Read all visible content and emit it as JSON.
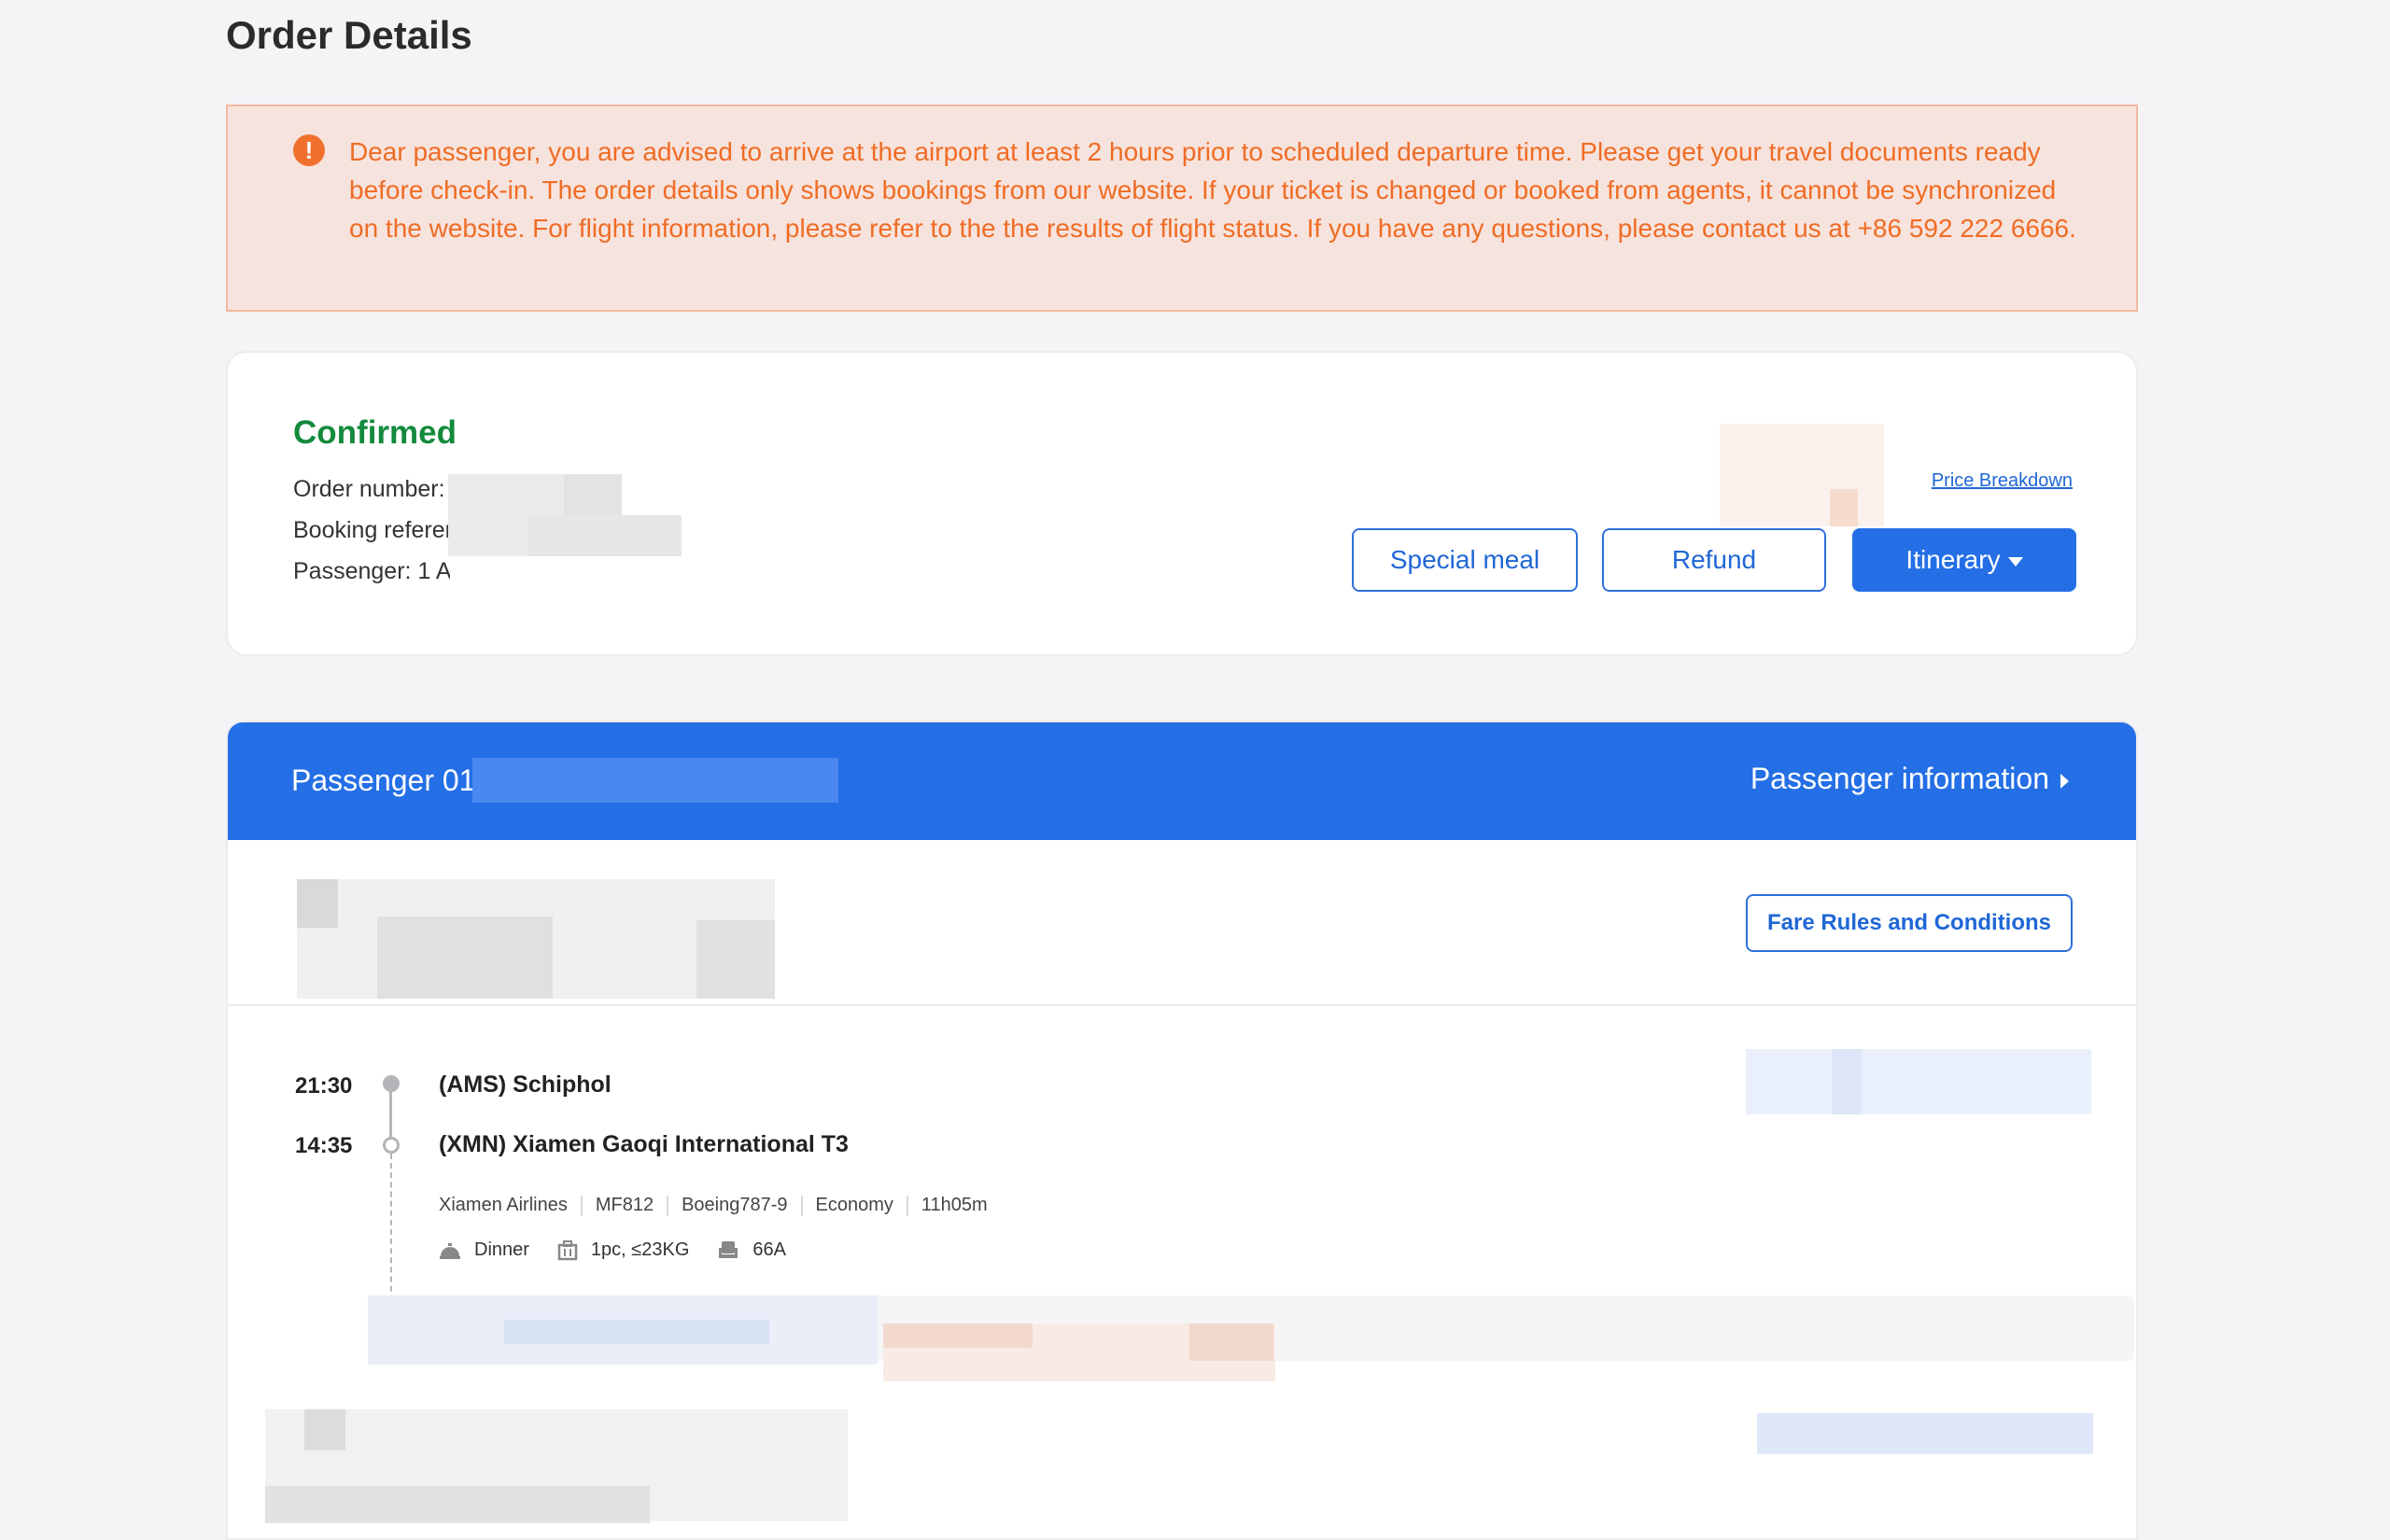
{
  "page": {
    "title": "Order Details"
  },
  "notice": {
    "text": "Dear passenger, you are advised to arrive at the airport at least 2 hours prior to scheduled departure time. Please get your travel documents ready before check-in. The order details only shows bookings from our website. If your ticket is changed or booked from agents, it cannot be synchronized on the website. For flight information, please refer to the the results of flight status. If you have any questions, please contact us at +86 592 222 6666.",
    "icon": "exclamation-icon"
  },
  "order": {
    "status": "Confirmed",
    "order_number_label": "Order number:",
    "booking_reference_label": "Booking referer",
    "passenger_label": "Passenger: 1 A(",
    "price_breakdown": "Price Breakdown",
    "buttons": {
      "special_meal": "Special meal",
      "refund": "Refund",
      "itinerary": "Itinerary"
    }
  },
  "passenger": {
    "header_label": "Passenger 01:",
    "info_link": "Passenger information",
    "fare_rules": "Fare Rules and Conditions"
  },
  "flight": {
    "departure_time": "21:30",
    "departure_airport": "(AMS) Schiphol",
    "arrival_time": "14:35",
    "arrival_airport": "(XMN) Xiamen Gaoqi International T3",
    "airline": "Xiamen Airlines",
    "flight_number": "MF812",
    "aircraft": "Boeing787-9",
    "cabin": "Economy",
    "duration": "11h05m",
    "meal": "Dinner",
    "baggage": "1pc, ≤23KG",
    "seat": "66A"
  },
  "colors": {
    "accent": "#246fe6",
    "confirmed": "#138a3c",
    "warning": "#ef6c25",
    "notice_bg": "#f7e3dd"
  }
}
